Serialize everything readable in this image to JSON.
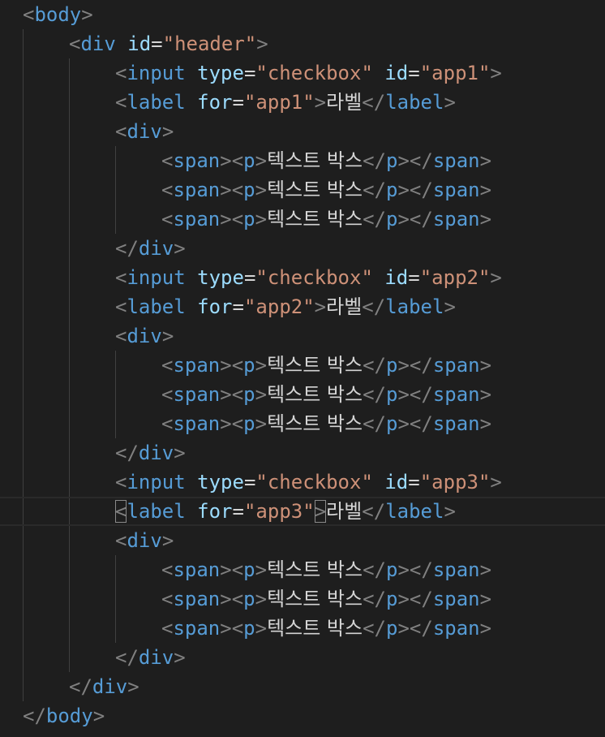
{
  "colors": {
    "background": "#1e1e1e",
    "punctuation": "#808080",
    "tag": "#569cd6",
    "attribute": "#9cdcfe",
    "string": "#ce9178",
    "text": "#d4d4d4",
    "indent_guide": "#404040",
    "active_line": "#2a2a2a"
  },
  "labels": {
    "body_tag": "body",
    "div_tag": "div",
    "input_tag": "input",
    "label_tag": "label",
    "span_tag": "span",
    "p_tag": "p",
    "id_attr": "id",
    "type_attr": "type",
    "for_attr": "for",
    "header_value": "\"header\"",
    "checkbox_value": "\"checkbox\"",
    "label_text": "라벨",
    "textbox_text": "텍스트 박스"
  },
  "groups": [
    {
      "id_value": "\"app1\""
    },
    {
      "id_value": "\"app2\""
    },
    {
      "id_value": "\"app3\""
    }
  ],
  "active_line_index": 17
}
